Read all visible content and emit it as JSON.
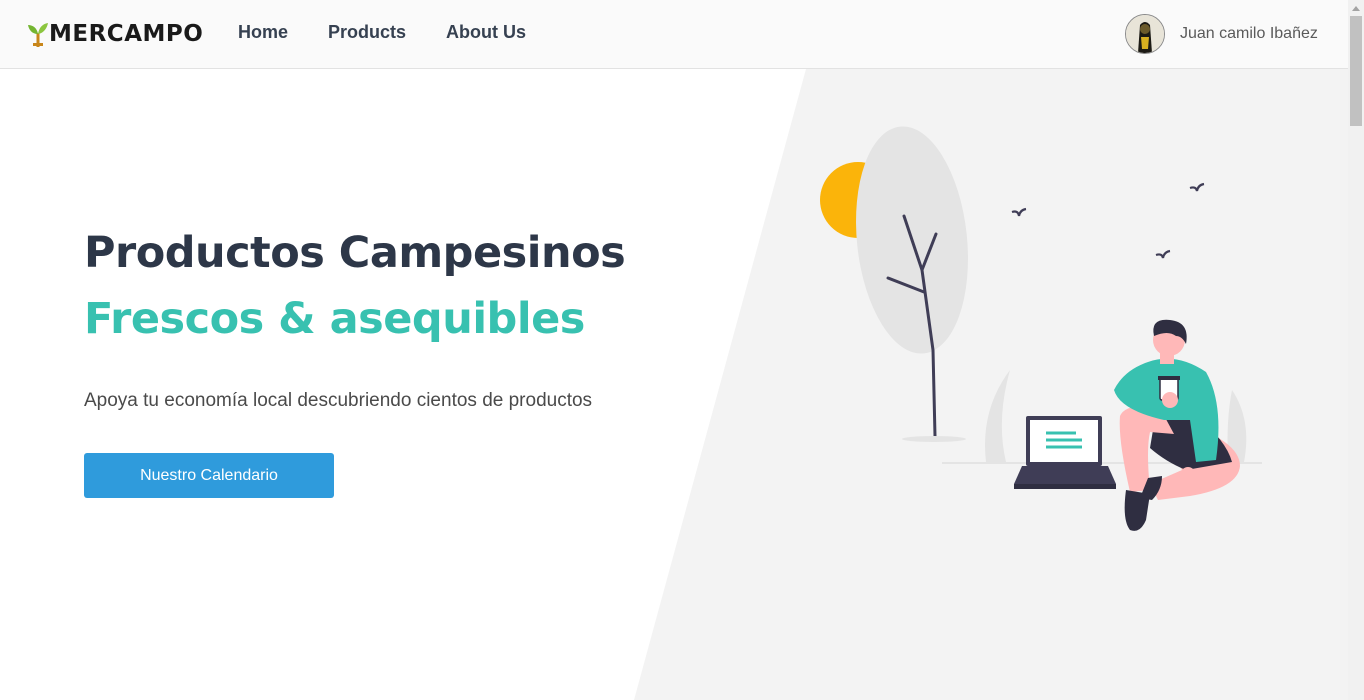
{
  "brand": {
    "name": "MERCAMPO",
    "logo_icon": "sprout-icon"
  },
  "nav": {
    "links": [
      {
        "label": "Home"
      },
      {
        "label": "Products"
      },
      {
        "label": "About Us"
      }
    ]
  },
  "user": {
    "name": "Juan camilo Ibañez"
  },
  "hero": {
    "title_line1": "Productos Campesinos",
    "title_line2": "Frescos & asequibles",
    "subtitle": "Apoya tu economía local descubriendo cientos de productos",
    "cta_label": "Nuestro Calendario"
  },
  "colors": {
    "accent_teal": "#38c1b0",
    "button_blue": "#2f9bdc",
    "heading_dark": "#2d3748",
    "hero_panel": "#f3f3f3",
    "sun": "#fbb40a"
  }
}
